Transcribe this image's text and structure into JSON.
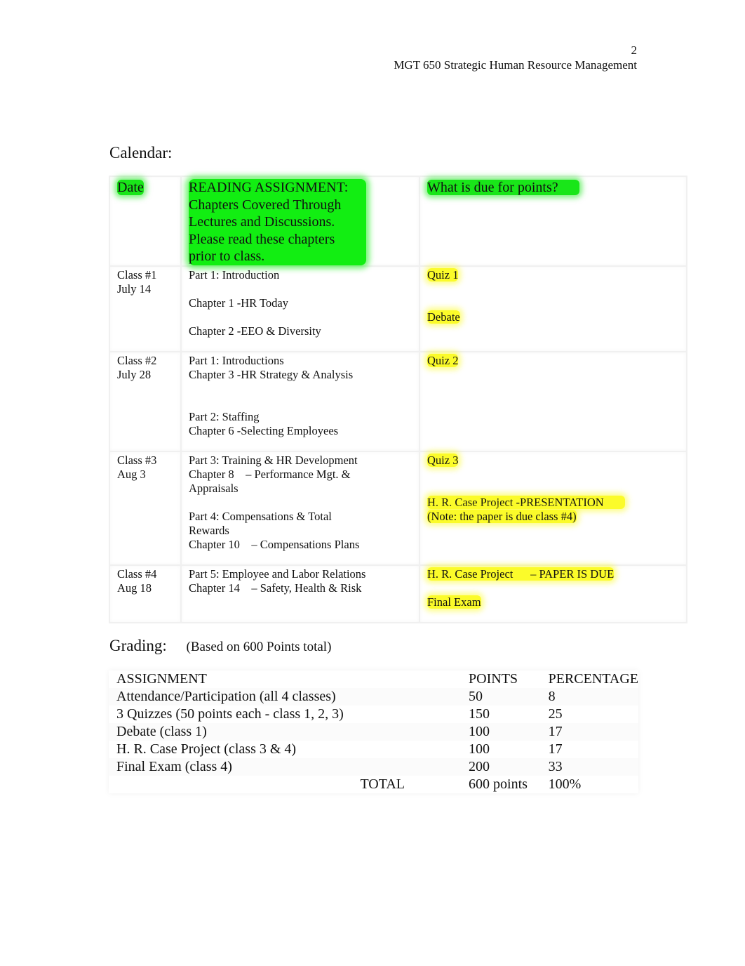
{
  "header": {
    "page_number": "2",
    "course_title": "MGT 650 Strategic Human Resource Management"
  },
  "calendar": {
    "title": "Calendar:",
    "columns": {
      "date": "Date",
      "reading_lines": [
        "READING ASSIGNMENT:",
        "Chapters Covered Through",
        "Lectures and Discussions.",
        "Please read these chapters",
        "prior to class."
      ],
      "due": "What is due for points?"
    },
    "rows": [
      {
        "class": "Class #1",
        "date": "July 14",
        "reading": [
          "Part 1: Introduction",
          "Chapter 1 -HR Today",
          "Chapter 2 -EEO & Diversity"
        ],
        "due": [
          "Quiz 1",
          "Debate"
        ]
      },
      {
        "class": "Class #2",
        "date": "July 28",
        "reading": [
          "Part 1: Introductions",
          "Chapter 3 -HR Strategy & Analysis",
          "Part 2: Staffing",
          "Chapter 6 -Selecting Employees"
        ],
        "due": [
          "Quiz 2"
        ]
      },
      {
        "class": "Class #3",
        "date": "Aug 3",
        "reading": [
          "Part 3: Training & HR Development",
          "Chapter 8    – Performance Mgt. &",
          "Appraisals",
          "Part 4: Compensations & Total",
          "Rewards",
          "Chapter 10    – Compensations Plans"
        ],
        "due": [
          "Quiz 3",
          "H. R. Case Project -PRESENTATION",
          "(Note: the paper is due class #4)"
        ]
      },
      {
        "class": "Class #4",
        "date": "Aug 18",
        "reading": [
          "Part 5: Employee and Labor Relations",
          "Chapter 14    – Safety, Health & Risk"
        ],
        "due": [
          "H. R. Case Project      – PAPER IS DUE",
          "Final Exam"
        ]
      }
    ]
  },
  "grading": {
    "title": "Grading:",
    "note": "(Based on 600 Points total)",
    "headers": [
      "ASSIGNMENT",
      "POINTS",
      "PERCENTAGE"
    ],
    "rows": [
      [
        "Attendance/Participation (all 4 classes)",
        "50",
        "8"
      ],
      [
        "3 Quizzes (50 points each - class 1, 2, 3)",
        "150",
        "25"
      ],
      [
        "Debate (class 1)",
        "100",
        "17"
      ],
      [
        "H. R. Case Project (class 3 & 4)",
        "100",
        "17"
      ],
      [
        "Final Exam (class 4)",
        "200",
        "33"
      ]
    ],
    "total": [
      "TOTAL",
      "600 points",
      "100%"
    ]
  },
  "colors": {
    "highlight_green": "#19e619",
    "highlight_yellow": "#fbfb2a"
  }
}
